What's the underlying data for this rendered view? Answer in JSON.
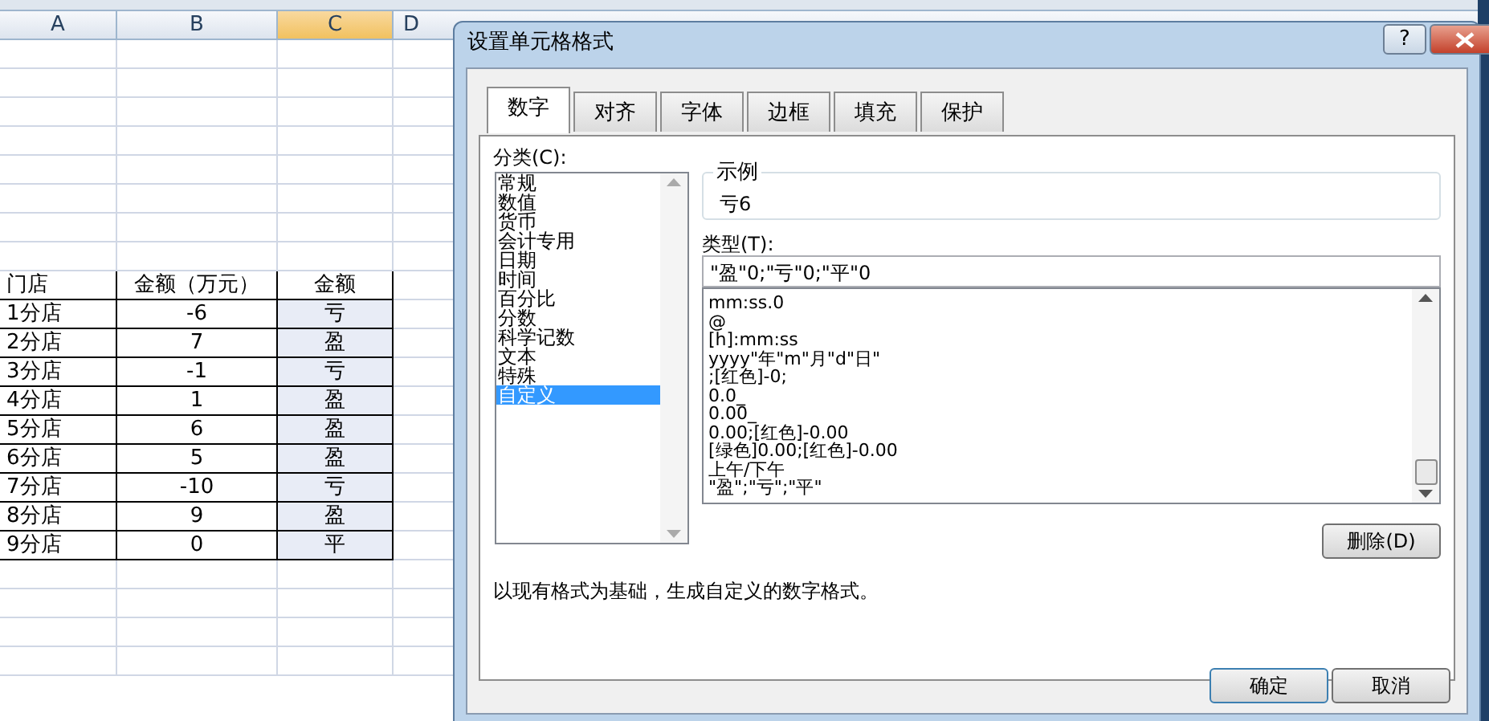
{
  "sheet": {
    "column_headers": [
      {
        "label": "A",
        "selected": false
      },
      {
        "label": "B",
        "selected": false
      },
      {
        "label": "C",
        "selected": true
      },
      {
        "label": "D",
        "selected": false
      }
    ],
    "table": {
      "columns": [
        "门店",
        "金额（万元）",
        "金额"
      ],
      "rows": [
        {
          "cells": [
            {
              "text": "1分店",
              "selected": false
            },
            {
              "text": "-6",
              "selected": false
            },
            {
              "text": "亏",
              "selected": true
            }
          ]
        },
        {
          "cells": [
            {
              "text": "2分店",
              "selected": false
            },
            {
              "text": "7",
              "selected": false
            },
            {
              "text": "盈",
              "selected": true
            }
          ]
        },
        {
          "cells": [
            {
              "text": "3分店",
              "selected": false
            },
            {
              "text": "-1",
              "selected": false
            },
            {
              "text": "亏",
              "selected": true
            }
          ]
        },
        {
          "cells": [
            {
              "text": "4分店",
              "selected": false
            },
            {
              "text": "1",
              "selected": false
            },
            {
              "text": "盈",
              "selected": true
            }
          ]
        },
        {
          "cells": [
            {
              "text": "5分店",
              "selected": false
            },
            {
              "text": "6",
              "selected": false
            },
            {
              "text": "盈",
              "selected": true
            }
          ]
        },
        {
          "cells": [
            {
              "text": "6分店",
              "selected": false
            },
            {
              "text": "5",
              "selected": false
            },
            {
              "text": "盈",
              "selected": true
            }
          ]
        },
        {
          "cells": [
            {
              "text": "7分店",
              "selected": false
            },
            {
              "text": "-10",
              "selected": false
            },
            {
              "text": "亏",
              "selected": true
            }
          ]
        },
        {
          "cells": [
            {
              "text": "8分店",
              "selected": false
            },
            {
              "text": "9",
              "selected": false
            },
            {
              "text": "盈",
              "selected": true
            }
          ]
        },
        {
          "cells": [
            {
              "text": "9分店",
              "selected": false
            },
            {
              "text": "0",
              "selected": false
            },
            {
              "text": "平",
              "selected": true
            }
          ]
        }
      ]
    }
  },
  "dialog": {
    "title": "设置单元格格式",
    "help_button": "?",
    "tabs": [
      {
        "label": "数字",
        "selected": true
      },
      {
        "label": "对齐",
        "selected": false
      },
      {
        "label": "字体",
        "selected": false
      },
      {
        "label": "边框",
        "selected": false
      },
      {
        "label": "填充",
        "selected": false
      },
      {
        "label": "保护",
        "selected": false
      }
    ],
    "category_label": "分类(C):",
    "categories": [
      {
        "label": "常规",
        "selected": false
      },
      {
        "label": "数值",
        "selected": false
      },
      {
        "label": "货币",
        "selected": false
      },
      {
        "label": "会计专用",
        "selected": false
      },
      {
        "label": "日期",
        "selected": false
      },
      {
        "label": "时间",
        "selected": false
      },
      {
        "label": "百分比",
        "selected": false
      },
      {
        "label": "分数",
        "selected": false
      },
      {
        "label": "科学记数",
        "selected": false
      },
      {
        "label": "文本",
        "selected": false
      },
      {
        "label": "特殊",
        "selected": false
      },
      {
        "label": "自定义",
        "selected": true
      }
    ],
    "sample_label": "示例",
    "sample_value": "亏6",
    "type_label": "类型(T):",
    "type_value": "\"盈\"0;\"亏\"0;\"平\"0",
    "formats": [
      {
        "label": "mm:ss.0",
        "selected": false
      },
      {
        "label": "@",
        "selected": false
      },
      {
        "label": "[h]:mm:ss",
        "selected": false
      },
      {
        "label": "yyyy\"年\"m\"月\"d\"日\"",
        "selected": false
      },
      {
        "label": ";[红色]-0;",
        "selected": false
      },
      {
        "label": "0.0_",
        "selected": false
      },
      {
        "label": "0.00_",
        "selected": false
      },
      {
        "label": "0.00;[红色]-0.00",
        "selected": false
      },
      {
        "label": "[绿色]0.00;[红色]-0.00",
        "selected": false
      },
      {
        "label": "上午/下午",
        "selected": false
      },
      {
        "label": "\"盈\";\"亏\";\"平\"",
        "selected": false
      }
    ],
    "delete_button": "删除(D)",
    "description": "以现有格式为基础，生成自定义的数字格式。",
    "ok_button": "确定",
    "cancel_button": "取消"
  }
}
